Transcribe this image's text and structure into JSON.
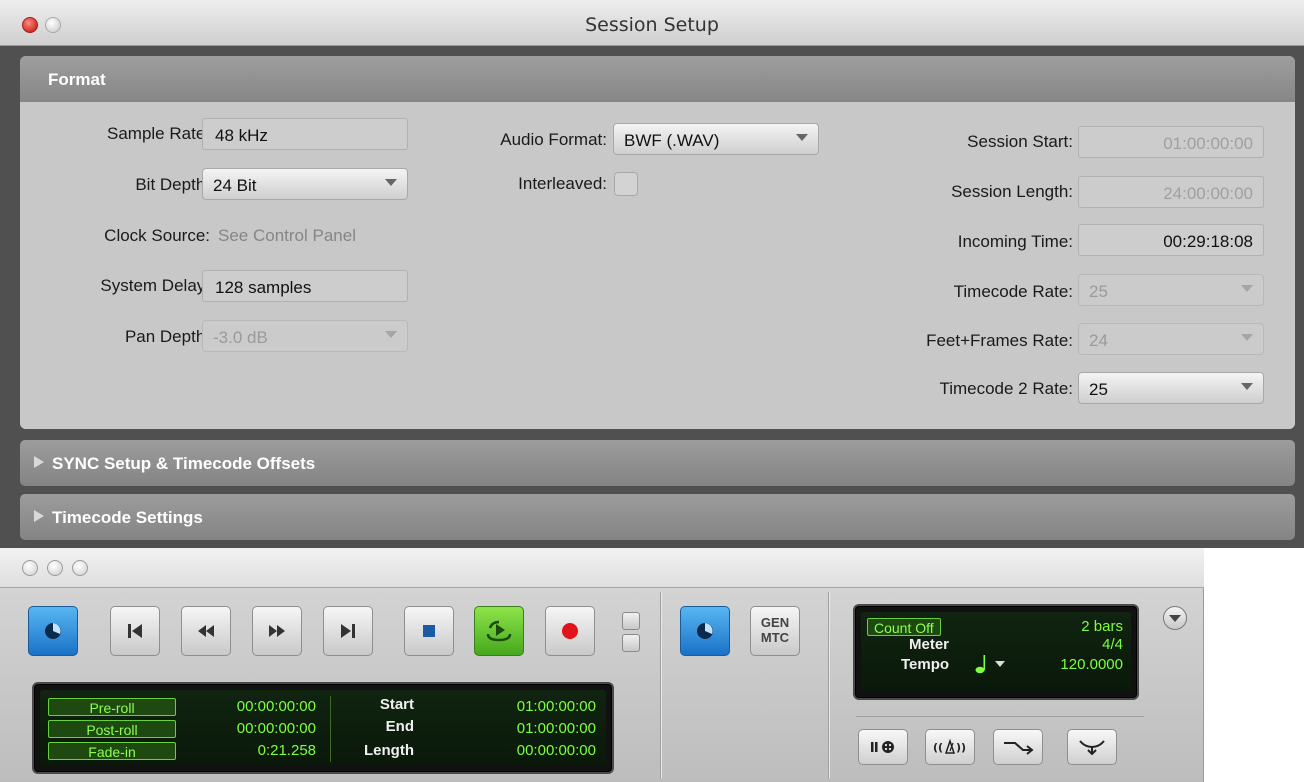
{
  "session_setup": {
    "window_title": "Session Setup",
    "format_section": {
      "header": "Format",
      "sample_rate": {
        "label": "Sample Rate:",
        "value": "48 kHz"
      },
      "bit_depth": {
        "label": "Bit Depth:",
        "value": "24 Bit"
      },
      "clock_source": {
        "label": "Clock Source:",
        "value": "See Control Panel"
      },
      "system_delay": {
        "label": "System Delay:",
        "value": "128 samples"
      },
      "pan_depth": {
        "label": "Pan Depth:",
        "value": "-3.0 dB"
      },
      "audio_format": {
        "label": "Audio Format:",
        "value": "BWF (.WAV)"
      },
      "interleaved": {
        "label": "Interleaved:",
        "checked": false
      },
      "session_start": {
        "label": "Session Start:",
        "value": "01:00:00:00"
      },
      "session_length": {
        "label": "Session Length:",
        "value": "24:00:00:00"
      },
      "incoming_time": {
        "label": "Incoming Time:",
        "value": "00:29:18:08"
      },
      "timecode_rate": {
        "label": "Timecode Rate:",
        "value": "25"
      },
      "feet_frames_rate": {
        "label": "Feet+Frames Rate:",
        "value": "24"
      },
      "timecode2_rate": {
        "label": "Timecode 2 Rate:",
        "value": "25"
      }
    },
    "sync_section": {
      "label": "SYNC Setup & Timecode Offsets"
    },
    "timecode_section": {
      "label": "Timecode Settings"
    }
  },
  "transport": {
    "counters": {
      "preroll": {
        "label": "Pre-roll",
        "value": "00:00:00:00"
      },
      "postroll": {
        "label": "Post-roll",
        "value": "00:00:00:00"
      },
      "fadein": {
        "label": "Fade-in",
        "value": "0:21.258"
      },
      "start": {
        "label": "Start",
        "value": "01:00:00:00"
      },
      "end": {
        "label": "End",
        "value": "01:00:00:00"
      },
      "length": {
        "label": "Length",
        "value": "00:00:00:00"
      }
    },
    "gen_mtc": {
      "line1": "GEN",
      "line2": "MTC"
    },
    "midi_display": {
      "count_off": "Count Off",
      "count_off_value": "2 bars",
      "meter_label": "Meter",
      "meter_value": "4/4",
      "tempo_label": "Tempo",
      "tempo_value": "120.0000"
    }
  },
  "colors": {
    "lcd_green": "#7dff3f",
    "play_green": "#45a81c",
    "online_blue": "#1a72c7",
    "record_red": "#e0151b"
  }
}
